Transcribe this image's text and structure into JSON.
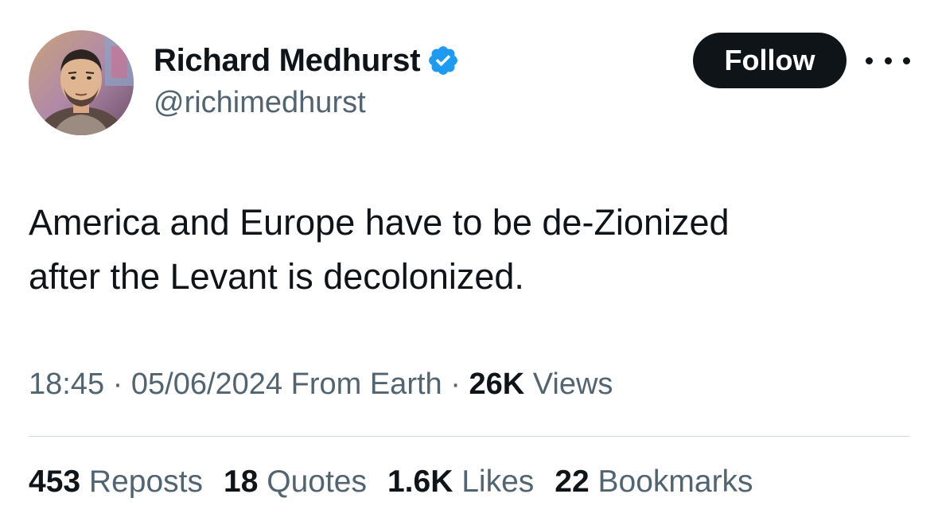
{
  "author": {
    "display_name": "Richard Medhurst",
    "handle": "@richimedhurst",
    "verified": true,
    "verified_color": "#1d9bf0"
  },
  "actions": {
    "follow_label": "Follow",
    "more_icon": "more-horizontal-icon"
  },
  "tweet": {
    "lines": [
      "America and Europe have to be de-Zionized",
      "after the Levant is decolonized."
    ]
  },
  "meta": {
    "time": "18:45",
    "separator": "·",
    "date": "05/06/2024",
    "source": "From Earth",
    "views_count": "26K",
    "views_label": "Views"
  },
  "stats": [
    {
      "count": "453",
      "label": "Reposts"
    },
    {
      "count": "18",
      "label": "Quotes"
    },
    {
      "count": "1.6K",
      "label": "Likes"
    },
    {
      "count": "22",
      "label": "Bookmarks"
    }
  ],
  "colors": {
    "text": "#0f1419",
    "secondary": "#536471",
    "divider": "#cfd9de",
    "button_bg": "#0f1419",
    "button_text": "#ffffff"
  }
}
